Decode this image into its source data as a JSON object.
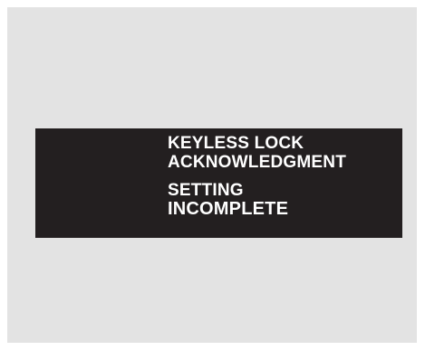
{
  "colors": {
    "background": "#e3e3e3",
    "panel": "#231f20",
    "text": "#ffffff"
  },
  "display": {
    "line1": "KEYLESS LOCK",
    "line2": "ACKNOWLEDGMENT",
    "line3": "SETTING",
    "line4": "INCOMPLETE"
  }
}
